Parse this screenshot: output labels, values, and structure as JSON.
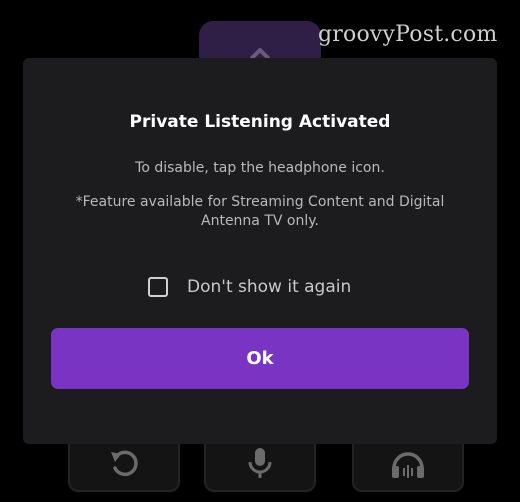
{
  "watermark": {
    "text": "groovyPost.com"
  },
  "remote": {
    "buttons": [
      {
        "icon": "chevron-up-icon"
      },
      {
        "icon": "replay-icon"
      },
      {
        "icon": "microphone-icon"
      },
      {
        "icon": "headphones-icon"
      }
    ]
  },
  "dialog": {
    "title": "Private Listening Activated",
    "message": "To disable, tap the headphone icon.",
    "note": "*Feature available for Streaming Content and Digital Antenna TV only.",
    "checkbox": {
      "label": "Don't show it again",
      "checked": false
    },
    "ok_label": "Ok"
  },
  "colors": {
    "background": "#000000",
    "dialog": "#1c1b1d",
    "accent": "#7a34c4",
    "up_button": "#2f1f46"
  }
}
